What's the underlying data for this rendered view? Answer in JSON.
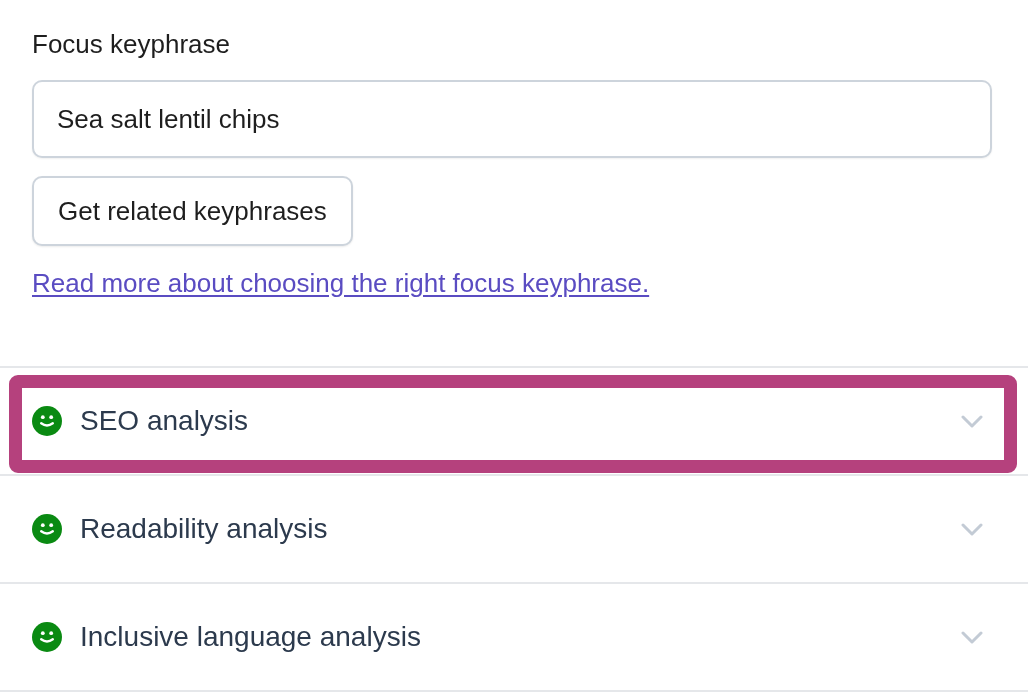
{
  "focus_keyphrase": {
    "label": "Focus keyphrase",
    "value": "Sea salt lentil chips"
  },
  "related_button": {
    "label": "Get related keyphrases"
  },
  "help_link": {
    "text": "Read more about choosing the right focus keyphrase."
  },
  "sections": [
    {
      "title": "SEO analysis",
      "color": "#0a8a12",
      "expanded": false,
      "highlighted": true
    },
    {
      "title": "Readability analysis",
      "color": "#0a8a12",
      "expanded": false,
      "highlighted": false
    },
    {
      "title": "Inclusive language analysis",
      "color": "#0a8a12",
      "expanded": false,
      "highlighted": false
    }
  ]
}
